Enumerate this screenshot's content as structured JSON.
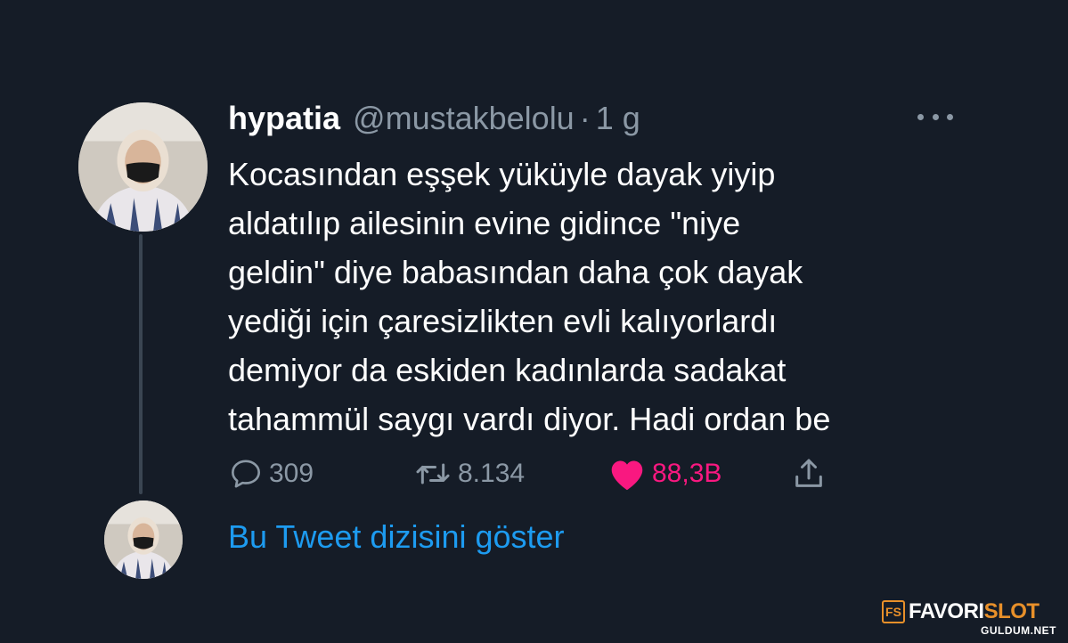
{
  "tweet": {
    "display_name": "hypatia",
    "handle": "@mustakbelolu",
    "separator": "·",
    "time": "1 g",
    "text_lines": [
      "Kocasından eşşek yüküyle dayak yiyip",
      "aldatılıp ailesinin evine gidince \"niye",
      "geldin\" diye babasından daha çok dayak",
      "yediği için çaresizlikten evli kalıyorlardı",
      "demiyor da eskiden kadınlarda sadakat",
      "tahammül saygı vardı diyor. Hadi ordan be"
    ],
    "replies": "309",
    "retweets": "8.134",
    "likes": "88,3B",
    "show_thread": "Bu Tweet dizisini göster"
  },
  "icons": {
    "reply": "reply-icon",
    "retweet": "retweet-icon",
    "like": "heart-icon",
    "share": "share-icon",
    "more": "more-icon"
  },
  "watermark": {
    "logo_letters": "FS",
    "brand_main": "FAVORI",
    "brand_accent": "SLOT",
    "sub": "GULDUM.NET"
  },
  "colors": {
    "background": "#151c27",
    "text": "#ffffff",
    "muted": "#8b98a5",
    "link": "#1d9bf0",
    "like": "#f91880",
    "watermark_accent": "#e8902a"
  }
}
